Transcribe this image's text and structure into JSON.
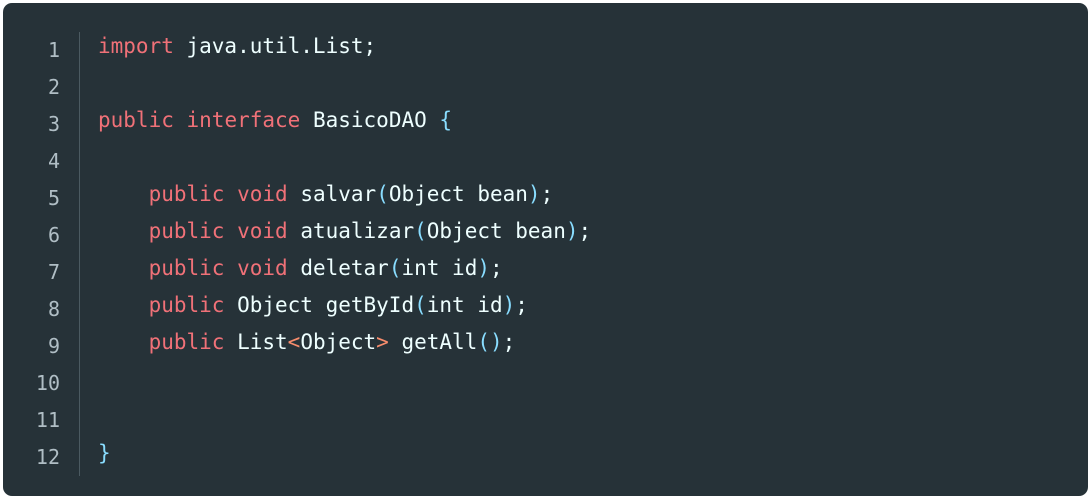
{
  "editor": {
    "line_numbers": [
      "1",
      "2",
      "3",
      "4",
      "5",
      "6",
      "7",
      "8",
      "9",
      "10",
      "11",
      "12"
    ],
    "lines": [
      {
        "tokens": [
          {
            "t": "import",
            "c": "kw"
          },
          {
            "t": " java.util.List;",
            "c": "pl"
          }
        ]
      },
      {
        "tokens": []
      },
      {
        "tokens": [
          {
            "t": "public",
            "c": "kw"
          },
          {
            "t": " ",
            "c": "pl"
          },
          {
            "t": "interface",
            "c": "kw"
          },
          {
            "t": " BasicoDAO ",
            "c": "pl"
          },
          {
            "t": "{",
            "c": "pu"
          }
        ]
      },
      {
        "tokens": []
      },
      {
        "tokens": [
          {
            "t": "    ",
            "c": "pl"
          },
          {
            "t": "public",
            "c": "kw"
          },
          {
            "t": " ",
            "c": "pl"
          },
          {
            "t": "void",
            "c": "kw"
          },
          {
            "t": " salvar",
            "c": "pl"
          },
          {
            "t": "(",
            "c": "pu"
          },
          {
            "t": "Object bean",
            "c": "pl"
          },
          {
            "t": ")",
            "c": "pu"
          },
          {
            "t": ";",
            "c": "pl"
          }
        ]
      },
      {
        "tokens": [
          {
            "t": "    ",
            "c": "pl"
          },
          {
            "t": "public",
            "c": "kw"
          },
          {
            "t": " ",
            "c": "pl"
          },
          {
            "t": "void",
            "c": "kw"
          },
          {
            "t": " atualizar",
            "c": "pl"
          },
          {
            "t": "(",
            "c": "pu"
          },
          {
            "t": "Object bean",
            "c": "pl"
          },
          {
            "t": ")",
            "c": "pu"
          },
          {
            "t": ";",
            "c": "pl"
          }
        ]
      },
      {
        "tokens": [
          {
            "t": "    ",
            "c": "pl"
          },
          {
            "t": "public",
            "c": "kw"
          },
          {
            "t": " ",
            "c": "pl"
          },
          {
            "t": "void",
            "c": "kw"
          },
          {
            "t": " deletar",
            "c": "pl"
          },
          {
            "t": "(",
            "c": "pu"
          },
          {
            "t": "int id",
            "c": "pl"
          },
          {
            "t": ")",
            "c": "pu"
          },
          {
            "t": ";",
            "c": "pl"
          }
        ]
      },
      {
        "tokens": [
          {
            "t": "    ",
            "c": "pl"
          },
          {
            "t": "public",
            "c": "kw"
          },
          {
            "t": " Object getById",
            "c": "pl"
          },
          {
            "t": "(",
            "c": "pu"
          },
          {
            "t": "int id",
            "c": "pl"
          },
          {
            "t": ")",
            "c": "pu"
          },
          {
            "t": ";",
            "c": "pl"
          }
        ]
      },
      {
        "tokens": [
          {
            "t": "    ",
            "c": "pl"
          },
          {
            "t": "public",
            "c": "kw"
          },
          {
            "t": " List",
            "c": "pl"
          },
          {
            "t": "<",
            "c": "ang"
          },
          {
            "t": "Object",
            "c": "pl"
          },
          {
            "t": ">",
            "c": "ang"
          },
          {
            "t": " getAll",
            "c": "pl"
          },
          {
            "t": "()",
            "c": "pu"
          },
          {
            "t": ";",
            "c": "pl"
          }
        ]
      },
      {
        "tokens": []
      },
      {
        "tokens": []
      },
      {
        "tokens": [
          {
            "t": "}",
            "c": "pu"
          }
        ]
      }
    ]
  },
  "colors": {
    "background": "#263238",
    "keyword": "#f07178",
    "plain": "#eeffff",
    "punctuation": "#89ddff",
    "angle_brackets": "#f78c6c",
    "line_number": "#b0bec5"
  }
}
